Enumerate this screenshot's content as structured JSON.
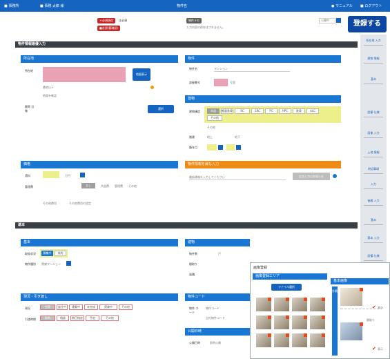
{
  "topbar": {
    "left_items": [
      "■ 事務所",
      "■ 事務 太郎 様"
    ],
    "center": "物件名",
    "right_items": [
      "● マニュアル",
      "■ ログアウト"
    ]
  },
  "header": {
    "required_tag": "＊必須項目",
    "required_note": "は必須",
    "sub_tag": "■必須(要確認)",
    "gray_tag": "物件メモ",
    "gray_note": "入力内容の保存はされません。",
    "select_value": "公開中",
    "register_label": "登録する"
  },
  "sidebar": {
    "items": [
      "所在地 入力",
      "建物 情報",
      "基本",
      "設備 仕様",
      "画像 入力",
      "土地 情報",
      "特記事項",
      "入力",
      "価格 入力",
      "基本",
      "基本 入力",
      "設備 仕様",
      "画像 入力"
    ]
  },
  "sections": {
    "property_input": "物件情報最優入力",
    "basic": "基本"
  },
  "location": {
    "header": "所在地",
    "address_label": "所在地",
    "address_button": "地図表示",
    "line1": "番地以下",
    "line2": "地図を確認",
    "transport_label": "最寄 沿線",
    "transport_button": "選択"
  },
  "property": {
    "header": "物件",
    "name_label": "物件名",
    "name_value": "マンション",
    "room_label": "部屋番号",
    "room_suffix": "号室"
  },
  "building": {
    "header": "建物",
    "structure_label": "建物構造",
    "structure_options": [
      "木造",
      "軽量鉄骨",
      "RC",
      "SRC",
      "PC",
      "HPC",
      "鉄骨",
      "ALC",
      "その他"
    ],
    "floor_label": "階建",
    "floor_a": "地上",
    "floor_b": "地下",
    "built_label": "築年月",
    "other_label": "その他"
  },
  "price": {
    "header": "価格",
    "price_label": "賃料",
    "price_suffix": "万円",
    "manage_label": "管理費",
    "manage_options": [
      "なし",
      "共益費",
      "管理費",
      "その他"
    ],
    "note_label": "その他費用",
    "note_value": "その他費用の設定"
  },
  "ad": {
    "header": "物件情報を最も入力",
    "placeholder": "最新情報を入力してください",
    "button": "広告入力のお知らせ"
  },
  "basic": {
    "header": "基本",
    "status_label": "取扱状況",
    "status_options": [
      "募集中",
      "成約"
    ],
    "type_label": "物件種別",
    "type_value": "賃貸マンション"
  },
  "move": {
    "header": "現況・引き渡し",
    "state_label": "現況",
    "state_options": [
      "空家",
      "居住中",
      "建築中",
      "未完成",
      "賃貸中",
      "その他"
    ],
    "timing_label": "引渡時期",
    "timing_options": [
      "即時",
      "相談",
      "期日指定",
      "予定",
      "その他"
    ]
  },
  "building2": {
    "header": "建物",
    "r1_label": "物件数",
    "r1_value": "戸",
    "r2_label": "間取り",
    "r3_label": "面積"
  },
  "code": {
    "header": "物件コード",
    "label": "物件 コード",
    "line1": "物件コード",
    "line2": "自社物件コード"
  },
  "publish": {
    "header": "公開日時",
    "label": "公開日時",
    "value": "即時公開"
  },
  "image_panel": {
    "title": "画像登録",
    "subheader": "画像登録エリア",
    "file_button": "ファイル選択",
    "right_header": "基本画像",
    "main_label": "外観",
    "main_caption": "間取り",
    "check_label": "表示"
  },
  "colors": {
    "topbar": "#1565c0",
    "panel_header": "#1976d2",
    "required_pink": "#e9a2b3",
    "highlight_yellow": "#ecef8a",
    "ad_orange": "#ef8a17"
  }
}
